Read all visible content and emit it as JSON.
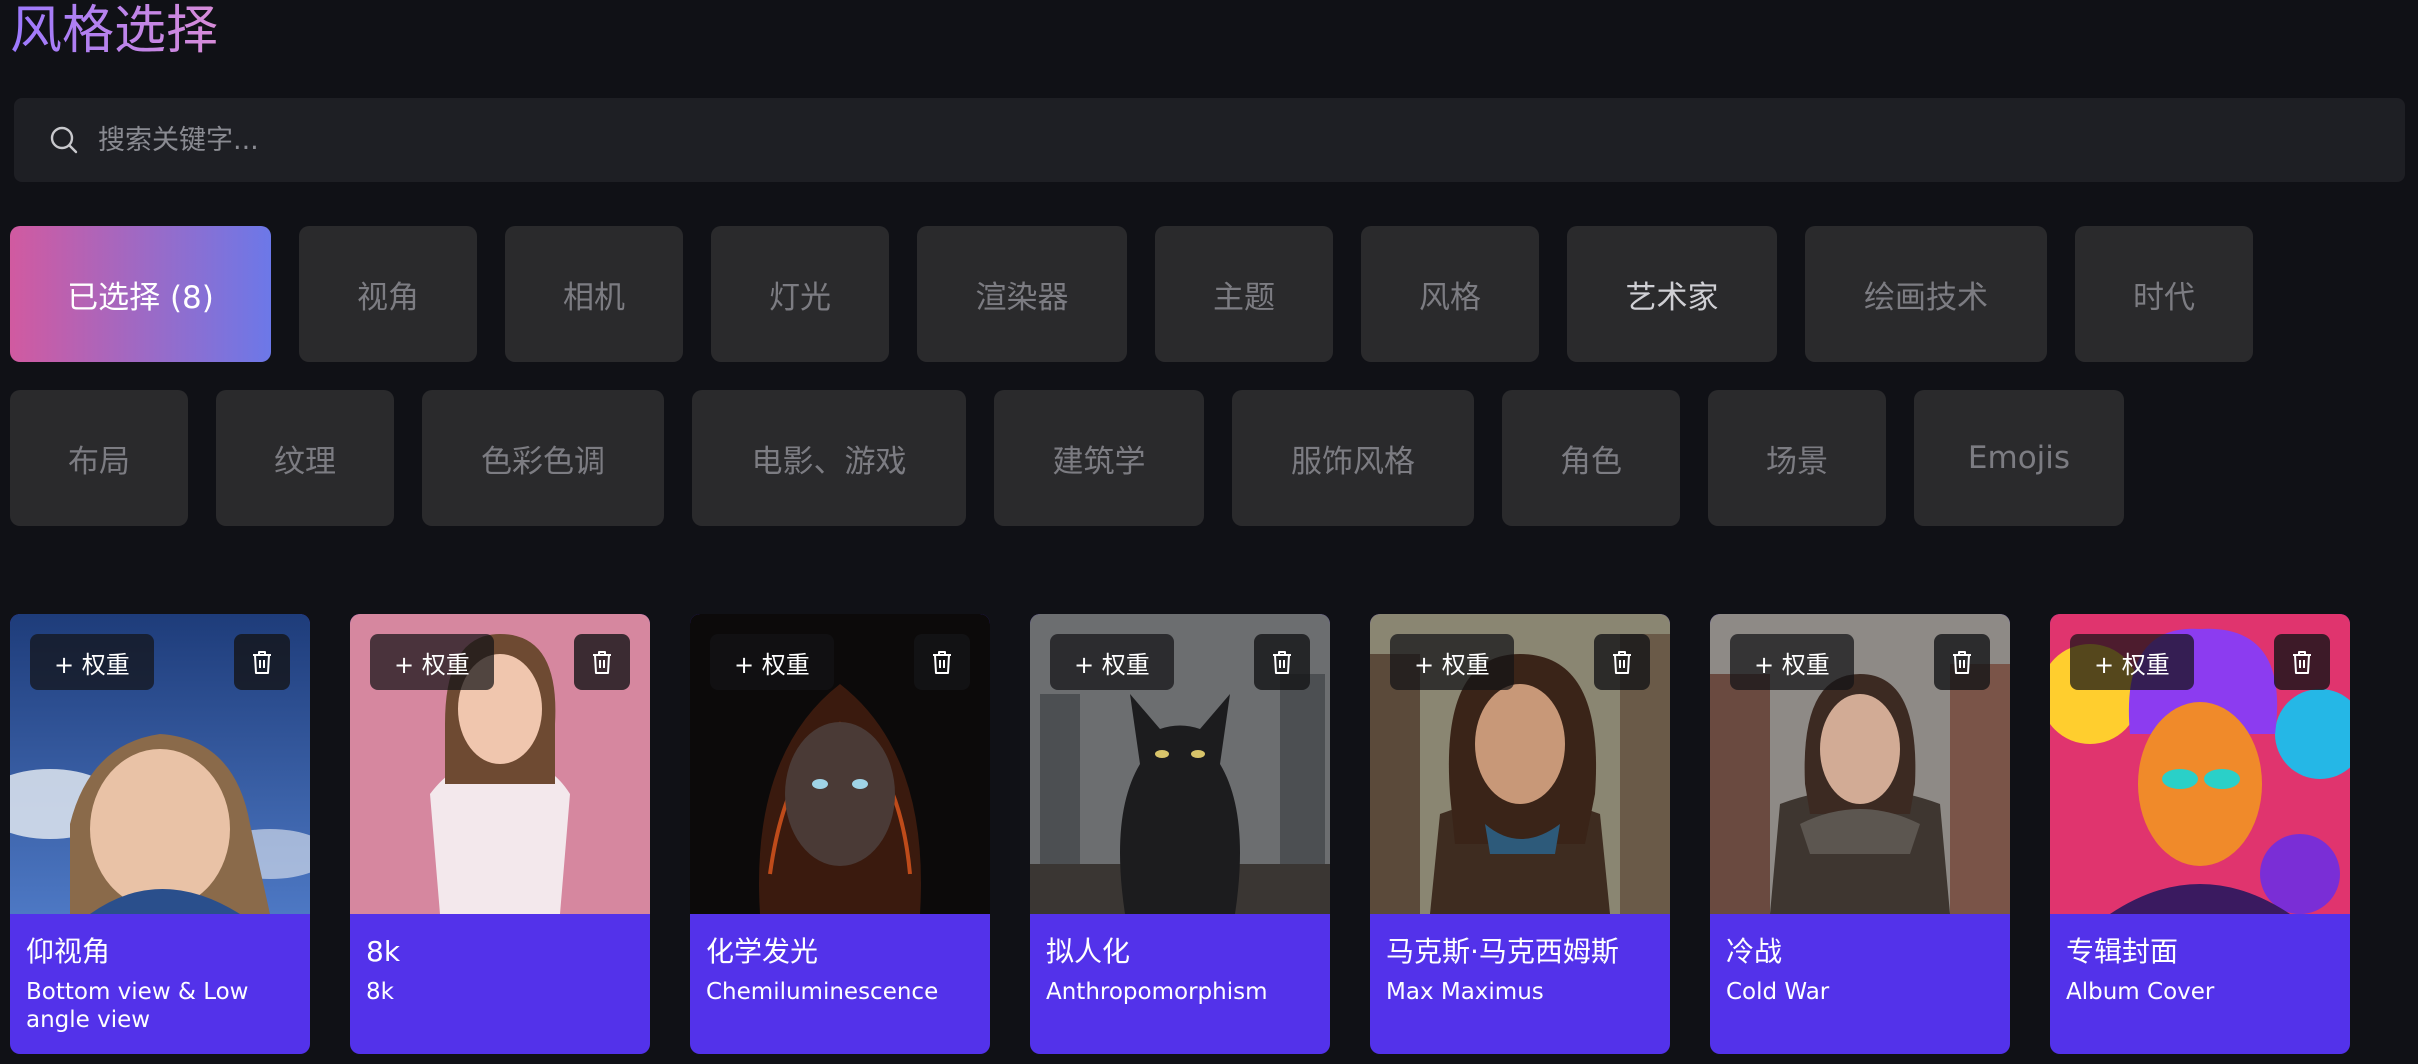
{
  "title": "风格选择",
  "search": {
    "placeholder": "搜索关键字..."
  },
  "categories_row1": [
    {
      "label": "已选择 (8)"
    },
    {
      "label": "视角"
    },
    {
      "label": "相机"
    },
    {
      "label": "灯光"
    },
    {
      "label": "渲染器"
    },
    {
      "label": "主题"
    },
    {
      "label": "风格"
    },
    {
      "label": "艺术家"
    },
    {
      "label": "绘画技术"
    },
    {
      "label": "时代"
    }
  ],
  "categories_row2": [
    {
      "label": "布局"
    },
    {
      "label": "纹理"
    },
    {
      "label": "色彩色调"
    },
    {
      "label": "电影、游戏"
    },
    {
      "label": "建筑学"
    },
    {
      "label": "服饰风格"
    },
    {
      "label": "角色"
    },
    {
      "label": "场景"
    },
    {
      "label": "Emojis"
    }
  ],
  "weight_label": "+ 权重",
  "cards": [
    {
      "name_cn": "仰视角",
      "name_en": "Bottom view & Low angle view"
    },
    {
      "name_cn": "8k",
      "name_en": "8k"
    },
    {
      "name_cn": "化学发光",
      "name_en": "Chemiluminescence"
    },
    {
      "name_cn": "拟人化",
      "name_en": "Anthropomorphism"
    },
    {
      "name_cn": "马克斯·马克西姆斯",
      "name_en": "Max Maximus"
    },
    {
      "name_cn": "冷战",
      "name_en": "Cold War"
    },
    {
      "name_cn": "专辑封面",
      "name_en": "Album Cover"
    }
  ],
  "colors": {
    "background": "#101116",
    "card_info": "#5332ea",
    "selected_gradient_start": "#d15aa0",
    "selected_gradient_end": "#6c78e8"
  }
}
